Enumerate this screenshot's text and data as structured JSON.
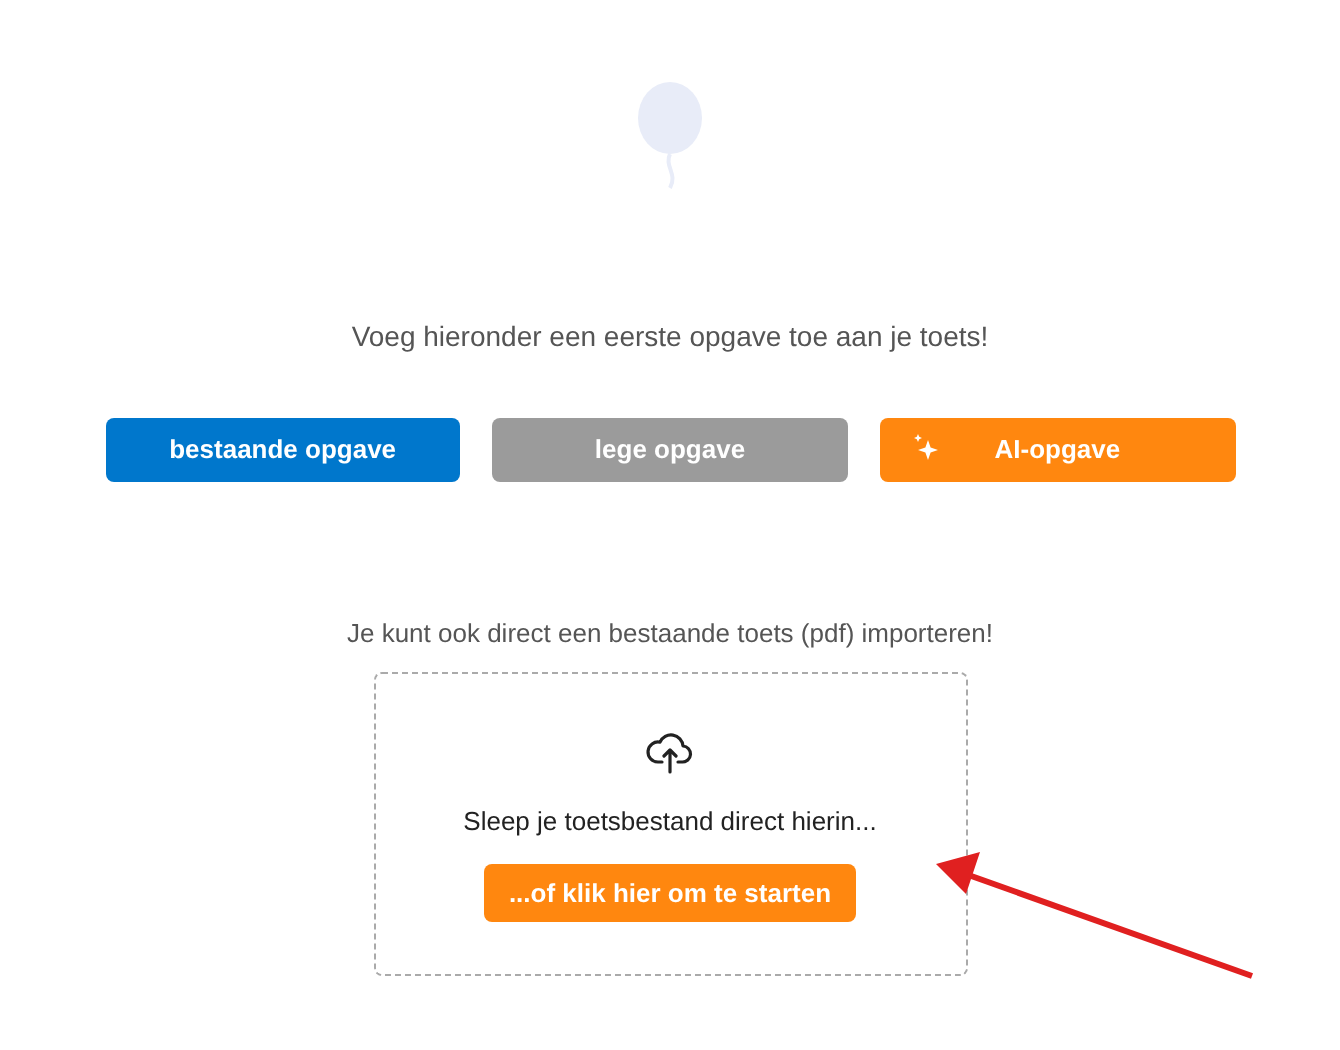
{
  "intro": "Voeg hieronder een eerste opgave toe aan je toets!",
  "buttons": [
    {
      "label": "bestaande opgave",
      "kind": "primary"
    },
    {
      "label": "lege opgave",
      "kind": "neutral"
    },
    {
      "label": "AI-opgave",
      "kind": "ai"
    }
  ],
  "import": {
    "hint": "Je kunt ook direct een bestaande toets (pdf) importeren!",
    "dropzone_text": "Sleep je toetsbestand direct hierin...",
    "button": "...of klik hier om te starten"
  }
}
